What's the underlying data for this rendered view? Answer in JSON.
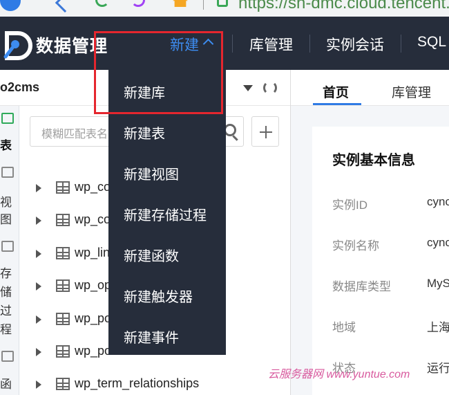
{
  "browser": {
    "url": "https://sh-dmc.cloud.tencent.c"
  },
  "header": {
    "app_title": "数据管理",
    "nav": {
      "new": "新建",
      "db_manage": "库管理",
      "instance_session": "实例会话",
      "sql": "SQL"
    }
  },
  "dropdown": {
    "items": [
      "新建库",
      "新建表",
      "新建视图",
      "新建存储过程",
      "新建函数",
      "新建触发器",
      "新建事件"
    ]
  },
  "database": {
    "name": "o2cms"
  },
  "search": {
    "placeholder": "模糊匹配表名"
  },
  "side_rail": {
    "labels": [
      "表",
      "视",
      "图",
      "存",
      "储",
      "过",
      "程",
      "函"
    ]
  },
  "tree": {
    "rows": [
      "wp_comments",
      "wp_commentmeta",
      "wp_links",
      "wp_options",
      "wp_postmeta",
      "wp_posts",
      "wp_term_relationships"
    ]
  },
  "tabs": {
    "home": "首页",
    "db_manage": "库管理"
  },
  "instance_info": {
    "title": "实例基本信息",
    "fields": [
      {
        "key": "实例ID",
        "value": "cync"
      },
      {
        "key": "实例名称",
        "value": "cync"
      },
      {
        "key": "数据库类型",
        "value": "MyS"
      },
      {
        "key": "地域",
        "value": "上海"
      },
      {
        "key": "状态",
        "value": "运行"
      }
    ]
  },
  "watermark": "云服务器网 www.yuntue.com",
  "colors": {
    "header_bg": "#262d3b",
    "accent": "#3d8cf0",
    "highlight": "#e5262e"
  }
}
